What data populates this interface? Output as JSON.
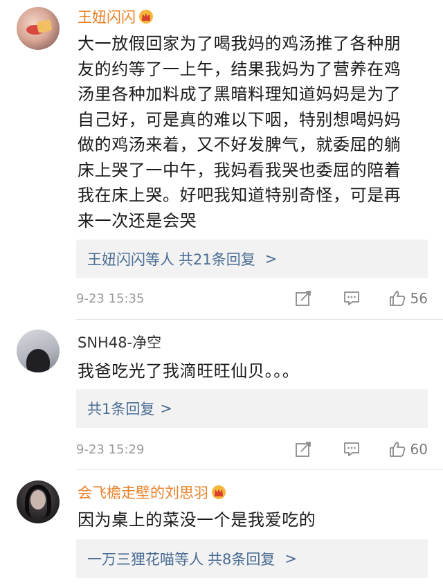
{
  "comments": [
    {
      "username": "王妞闪闪",
      "content_lines": [
        "大一放假回家为了喝我妈的鸡汤推了各种朋",
        "友的约等了一上午，结果我妈为了营养在鸡",
        "汤里各种加料成了黑暗料理知道妈妈是为了",
        "自己好，可是真的难以下咽，特别想喝妈妈",
        "做的鸡汤来着，又不好发脾气，就委屈的躺",
        "床上哭了一中午，我妈看我哭也委屈的陪着",
        "我在床上哭。好吧我知道特别奇怪，可是再",
        "来一次还是会哭"
      ],
      "reply_users": "王妞闪闪等人",
      "reply_count": "共21条回复",
      "reply_chevron": ">",
      "time": "9-23 15:35",
      "likes": "56"
    },
    {
      "username": "SNH48-净空",
      "content_lines": [
        "我爸吃光了我滴旺旺仙贝。。。"
      ],
      "reply_users": "",
      "reply_count": "共1条回复",
      "reply_chevron": ">",
      "time": "9-23 15:29",
      "likes": "60"
    },
    {
      "username": "会飞檐走壁的刘思羽",
      "content_lines": [
        "因为桌上的菜没一个是我爱吃的"
      ],
      "reply_users": "一万三狸花喵等人",
      "reply_count": "共8条回复",
      "reply_chevron": ">"
    }
  ],
  "icons": {
    "crown": "crown-badge-icon",
    "share": "share-edit-icon",
    "reply": "comment-bubble-icon",
    "like": "thumbs-up-icon"
  },
  "colors": {
    "vip_name": "#e8822b",
    "link": "#4a6c93",
    "reply_bg": "#f2f2f2",
    "meta": "#9a9a9a"
  }
}
